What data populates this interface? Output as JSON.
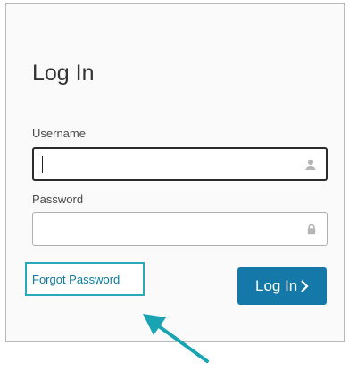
{
  "login": {
    "title": "Log In",
    "username_label": "Username",
    "username_value": "",
    "password_label": "Password",
    "password_value": "",
    "forgot_password": "Forgot Password",
    "submit_label": "Log In"
  },
  "icons": {
    "username": "user-icon",
    "password": "lock-icon",
    "submit": "chevron-right-icon",
    "annotation": "arrow-icon"
  },
  "colors": {
    "accent": "#1479a8",
    "highlight": "#2aa9b8",
    "link": "#0d7a9c"
  }
}
